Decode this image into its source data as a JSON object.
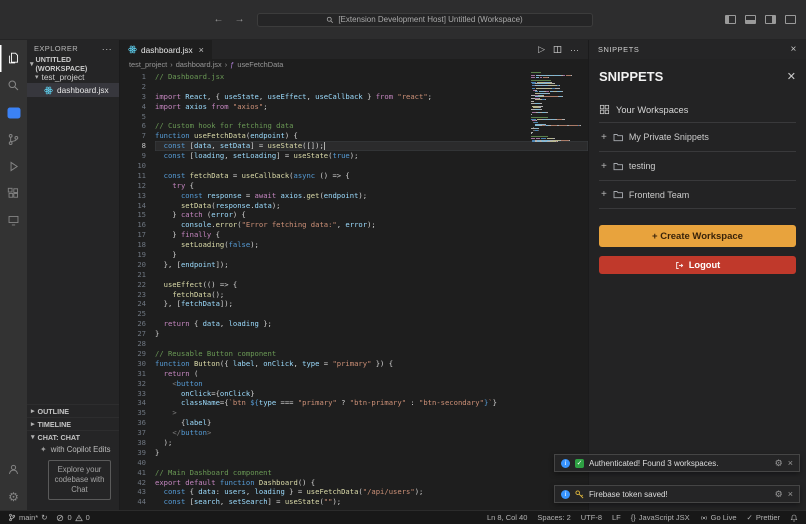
{
  "title_bar": {
    "search_text": "[Extension Development Host] Untitled (Workspace)",
    "back": "←",
    "forward": "→"
  },
  "explorer": {
    "title": "EXPLORER",
    "workspace_label": "UNTITLED (WORKSPACE)",
    "folder": "test_project",
    "file": "dashboard.jsx",
    "outline": "OUTLINE",
    "timeline": "TIMELINE",
    "chat": "CHAT: CHAT",
    "chat_item": "with Copilot Edits",
    "chat_welcome": "Explore your codebase with Chat"
  },
  "editor": {
    "tab": "dashboard.jsx",
    "breadcrumbs": [
      "test_project",
      "dashboard.jsx",
      "useFetchData"
    ],
    "active_line": 8,
    "code": [
      [
        [
          "c",
          "// Dashboard.jsx"
        ]
      ],
      [],
      [
        [
          "m",
          "import"
        ],
        [
          "d",
          " "
        ],
        [
          "v",
          "React"
        ],
        [
          "d",
          ", { "
        ],
        [
          "v",
          "useState"
        ],
        [
          "d",
          ", "
        ],
        [
          "v",
          "useEffect"
        ],
        [
          "d",
          ", "
        ],
        [
          "v",
          "useCallback"
        ],
        [
          "d",
          " } "
        ],
        [
          "m",
          "from"
        ],
        [
          "d",
          " "
        ],
        [
          "s",
          "\"react\""
        ],
        [
          "d",
          ";"
        ]
      ],
      [
        [
          "m",
          "import"
        ],
        [
          "d",
          " "
        ],
        [
          "v",
          "axios"
        ],
        [
          "d",
          " "
        ],
        [
          "m",
          "from"
        ],
        [
          "d",
          " "
        ],
        [
          "s",
          "\"axios\""
        ],
        [
          "d",
          ";"
        ]
      ],
      [],
      [
        [
          "c",
          "// Custom hook for fetching data"
        ]
      ],
      [
        [
          "k",
          "function"
        ],
        [
          "d",
          " "
        ],
        [
          "f",
          "useFetchData"
        ],
        [
          "d",
          "("
        ],
        [
          "v",
          "endpoint"
        ],
        [
          "d",
          ") {"
        ]
      ],
      [
        [
          "d",
          "  "
        ],
        [
          "k",
          "const"
        ],
        [
          "d",
          " ["
        ],
        [
          "v",
          "data"
        ],
        [
          "d",
          ", "
        ],
        [
          "v",
          "setData"
        ],
        [
          "d",
          "] = "
        ],
        [
          "f",
          "useState"
        ],
        [
          "d",
          "([]);"
        ]
      ],
      [
        [
          "d",
          "  "
        ],
        [
          "k",
          "const"
        ],
        [
          "d",
          " ["
        ],
        [
          "v",
          "loading"
        ],
        [
          "d",
          ", "
        ],
        [
          "v",
          "setLoading"
        ],
        [
          "d",
          "] = "
        ],
        [
          "f",
          "useState"
        ],
        [
          "d",
          "("
        ],
        [
          "k",
          "true"
        ],
        [
          "d",
          ");"
        ]
      ],
      [],
      [
        [
          "d",
          "  "
        ],
        [
          "k",
          "const"
        ],
        [
          "d",
          " "
        ],
        [
          "f",
          "fetchData"
        ],
        [
          "d",
          " = "
        ],
        [
          "f",
          "useCallback"
        ],
        [
          "d",
          "("
        ],
        [
          "k",
          "async"
        ],
        [
          "d",
          " () => {"
        ]
      ],
      [
        [
          "d",
          "    "
        ],
        [
          "m",
          "try"
        ],
        [
          "d",
          " {"
        ]
      ],
      [
        [
          "d",
          "      "
        ],
        [
          "k",
          "const"
        ],
        [
          "d",
          " "
        ],
        [
          "v",
          "response"
        ],
        [
          "d",
          " = "
        ],
        [
          "m",
          "await"
        ],
        [
          "d",
          " "
        ],
        [
          "v",
          "axios"
        ],
        [
          "d",
          "."
        ],
        [
          "f",
          "get"
        ],
        [
          "d",
          "("
        ],
        [
          "v",
          "endpoint"
        ],
        [
          "d",
          ");"
        ]
      ],
      [
        [
          "d",
          "      "
        ],
        [
          "f",
          "setData"
        ],
        [
          "d",
          "("
        ],
        [
          "v",
          "response"
        ],
        [
          "d",
          "."
        ],
        [
          "v",
          "data"
        ],
        [
          "d",
          ");"
        ]
      ],
      [
        [
          "d",
          "    } "
        ],
        [
          "m",
          "catch"
        ],
        [
          "d",
          " ("
        ],
        [
          "v",
          "error"
        ],
        [
          "d",
          ") {"
        ]
      ],
      [
        [
          "d",
          "      "
        ],
        [
          "v",
          "console"
        ],
        [
          "d",
          "."
        ],
        [
          "f",
          "error"
        ],
        [
          "d",
          "("
        ],
        [
          "s",
          "\"Error fetching data:\""
        ],
        [
          "d",
          ", "
        ],
        [
          "v",
          "error"
        ],
        [
          "d",
          ");"
        ]
      ],
      [
        [
          "d",
          "    } "
        ],
        [
          "m",
          "finally"
        ],
        [
          "d",
          " {"
        ]
      ],
      [
        [
          "d",
          "      "
        ],
        [
          "f",
          "setLoading"
        ],
        [
          "d",
          "("
        ],
        [
          "k",
          "false"
        ],
        [
          "d",
          ");"
        ]
      ],
      [
        [
          "d",
          "    }"
        ]
      ],
      [
        [
          "d",
          "  }, ["
        ],
        [
          "v",
          "endpoint"
        ],
        [
          "d",
          "]);"
        ]
      ],
      [],
      [
        [
          "d",
          "  "
        ],
        [
          "f",
          "useEffect"
        ],
        [
          "d",
          "(() => {"
        ]
      ],
      [
        [
          "d",
          "    "
        ],
        [
          "f",
          "fetchData"
        ],
        [
          "d",
          "();"
        ]
      ],
      [
        [
          "d",
          "  }, ["
        ],
        [
          "v",
          "fetchData"
        ],
        [
          "d",
          "]);"
        ]
      ],
      [],
      [
        [
          "d",
          "  "
        ],
        [
          "m",
          "return"
        ],
        [
          "d",
          " { "
        ],
        [
          "v",
          "data"
        ],
        [
          "d",
          ", "
        ],
        [
          "v",
          "loading"
        ],
        [
          "d",
          " };"
        ]
      ],
      [
        [
          "d",
          "}"
        ]
      ],
      [],
      [
        [
          "c",
          "// Reusable Button component"
        ]
      ],
      [
        [
          "k",
          "function"
        ],
        [
          "d",
          " "
        ],
        [
          "f",
          "Button"
        ],
        [
          "d",
          "({ "
        ],
        [
          "v",
          "label"
        ],
        [
          "d",
          ", "
        ],
        [
          "v",
          "onClick"
        ],
        [
          "d",
          ", "
        ],
        [
          "v",
          "type"
        ],
        [
          "d",
          " = "
        ],
        [
          "s",
          "\"primary\""
        ],
        [
          "d",
          " }) {"
        ]
      ],
      [
        [
          "d",
          "  "
        ],
        [
          "m",
          "return"
        ],
        [
          "d",
          " ("
        ]
      ],
      [
        [
          "d",
          "    "
        ],
        [
          "t",
          "<"
        ],
        [
          "k",
          "button"
        ]
      ],
      [
        [
          "d",
          "      "
        ],
        [
          "v",
          "onClick"
        ],
        [
          "d",
          "={"
        ],
        [
          "v",
          "onClick"
        ],
        [
          "d",
          "}"
        ]
      ],
      [
        [
          "d",
          "      "
        ],
        [
          "v",
          "className"
        ],
        [
          "d",
          "={"
        ],
        [
          "s",
          "`btn "
        ],
        [
          "k",
          "${"
        ],
        [
          "v",
          "type"
        ],
        [
          "d",
          " === "
        ],
        [
          "s",
          "\"primary\""
        ],
        [
          "d",
          " ? "
        ],
        [
          "s",
          "\"btn-primary\""
        ],
        [
          "d",
          " : "
        ],
        [
          "s",
          "\"btn-secondary\""
        ],
        [
          "k",
          "}"
        ],
        [
          "s",
          "`"
        ],
        [
          "d",
          "}"
        ]
      ],
      [
        [
          "d",
          "    "
        ],
        [
          "t",
          ">"
        ]
      ],
      [
        [
          "d",
          "      {"
        ],
        [
          "v",
          "label"
        ],
        [
          "d",
          "}"
        ]
      ],
      [
        [
          "d",
          "    "
        ],
        [
          "t",
          "</"
        ],
        [
          "k",
          "button"
        ],
        [
          "t",
          ">"
        ]
      ],
      [
        [
          "d",
          "  );"
        ]
      ],
      [
        [
          "d",
          "}"
        ]
      ],
      [],
      [
        [
          "c",
          "// Main Dashboard component"
        ]
      ],
      [
        [
          "m",
          "export"
        ],
        [
          "d",
          " "
        ],
        [
          "m",
          "default"
        ],
        [
          "d",
          " "
        ],
        [
          "k",
          "function"
        ],
        [
          "d",
          " "
        ],
        [
          "f",
          "Dashboard"
        ],
        [
          "d",
          "() {"
        ]
      ],
      [
        [
          "d",
          "  "
        ],
        [
          "k",
          "const"
        ],
        [
          "d",
          " { "
        ],
        [
          "v",
          "data"
        ],
        [
          "d",
          ": "
        ],
        [
          "v",
          "users"
        ],
        [
          "d",
          ", "
        ],
        [
          "v",
          "loading"
        ],
        [
          "d",
          " } = "
        ],
        [
          "f",
          "useFetchData"
        ],
        [
          "d",
          "("
        ],
        [
          "s",
          "\"/api/users\""
        ],
        [
          "d",
          ");"
        ]
      ],
      [
        [
          "d",
          "  "
        ],
        [
          "k",
          "const"
        ],
        [
          "d",
          " ["
        ],
        [
          "v",
          "search"
        ],
        [
          "d",
          ", "
        ],
        [
          "v",
          "setSearch"
        ],
        [
          "d",
          "] = "
        ],
        [
          "f",
          "useState"
        ],
        [
          "d",
          "("
        ],
        [
          "s",
          "\"\""
        ],
        [
          "d",
          ");"
        ]
      ]
    ]
  },
  "panel": {
    "tab_title": "SNIPPETS",
    "heading": "SNIPPETS",
    "section": "Your Workspaces",
    "workspaces": [
      "My Private Snippets",
      "testing",
      "Frontend Team"
    ],
    "create_button": "+ Create Workspace",
    "logout_button": "Logout"
  },
  "notifications": [
    {
      "icon": "check",
      "text": "Authenticated! Found 3 workspaces."
    },
    {
      "icon": "key",
      "text": "Firebase token saved!"
    }
  ],
  "status_bar": {
    "branch": "main*",
    "sync": "↻",
    "errors": "0",
    "warnings": "0",
    "line_col": "Ln 8, Col 40",
    "spaces": "Spaces: 2",
    "encoding": "UTF-8",
    "eol": "LF",
    "lang_icon": "{}",
    "language": "JavaScript JSX",
    "go_live": "Go Live",
    "prettier_check": "✓",
    "prettier": "Prettier"
  },
  "colors": {
    "accent_create": "#e8a33d",
    "accent_logout": "#c0392b",
    "info_blue": "#3794ff",
    "react_blue": "#61dafb"
  }
}
